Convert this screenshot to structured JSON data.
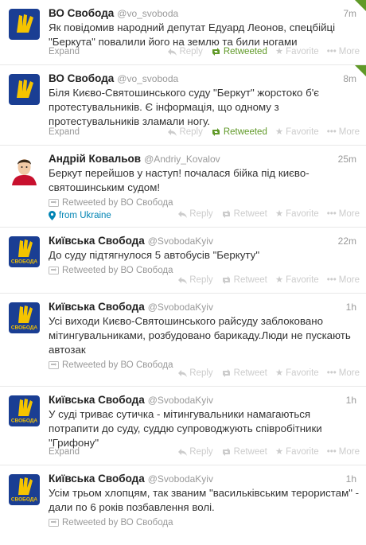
{
  "icons": {
    "reply": "reply-icon",
    "retweet": "retweet-icon",
    "favorite": "star-icon",
    "more": "more-icon",
    "retweeted_context": "retweet-context-icon",
    "location": "location-pin-icon"
  },
  "colors": {
    "link": "#0084b4",
    "retweet_green": "#609928",
    "muted": "#999999",
    "disabled": "#cccccc"
  },
  "labels": {
    "expand": "Expand",
    "reply": "Reply",
    "retweet": "Retweet",
    "retweeted": "Retweeted",
    "favorite": "Favorite",
    "more": "More"
  },
  "tweets": [
    {
      "name": "ВО Свобода",
      "handle": "@vo_svoboda",
      "time": "7m",
      "text": "Як повідомив народний депутат Едуард Леонов, спецбійці \"Беркута\" повалили його на землю та били ногами",
      "retweeted": true
    },
    {
      "name": "ВО Свобода",
      "handle": "@vo_svoboda",
      "time": "8m",
      "text": "Біля Києво-Святошинського суду \"Беркут\" жорстоко б'є протестувальників. Є інформація, що одному з протестувальників зламали ногу.",
      "retweeted": true
    },
    {
      "name": "Андрій Ковальов",
      "handle": "@Andriy_Kovalov",
      "time": "25m",
      "text": "Беркут перейшов у наступ! почалася бійка під києво-святошинським судом!",
      "context": "Retweeted by ВО Свобода",
      "location": "from Ukraine"
    },
    {
      "name": "Київська Свобода",
      "handle": "@SvobodaKyiv",
      "time": "22m",
      "text": "До суду підтягнулося 5 автобусів \"Беркуту\"",
      "context": "Retweeted by ВО Свобода"
    },
    {
      "name": "Київська Свобода",
      "handle": "@SvobodaKyiv",
      "time": "1h",
      "text": "Усі виходи Києво-Святошинського райсуду заблоковано мітингувальниками, розбудовано барикаду.Люди не пускають автозак",
      "context": "Retweeted by ВО Свобода"
    },
    {
      "name": "Київська Свобода",
      "handle": "@SvobodaKyiv",
      "time": "1h",
      "text": "У суді триває сутичка - мітингувальники намагаються потрапити до суду, суддю супроводжують співробітники \"Грифону\""
    },
    {
      "name": "Київська Свобода",
      "handle": "@SvobodaKyiv",
      "time": "1h",
      "text": "Усім трьом хлопцям, так званим \"васильківським терористам\" - дали по 6 років позбавлення волі.",
      "context": "Retweeted by ВО Свобода"
    }
  ]
}
